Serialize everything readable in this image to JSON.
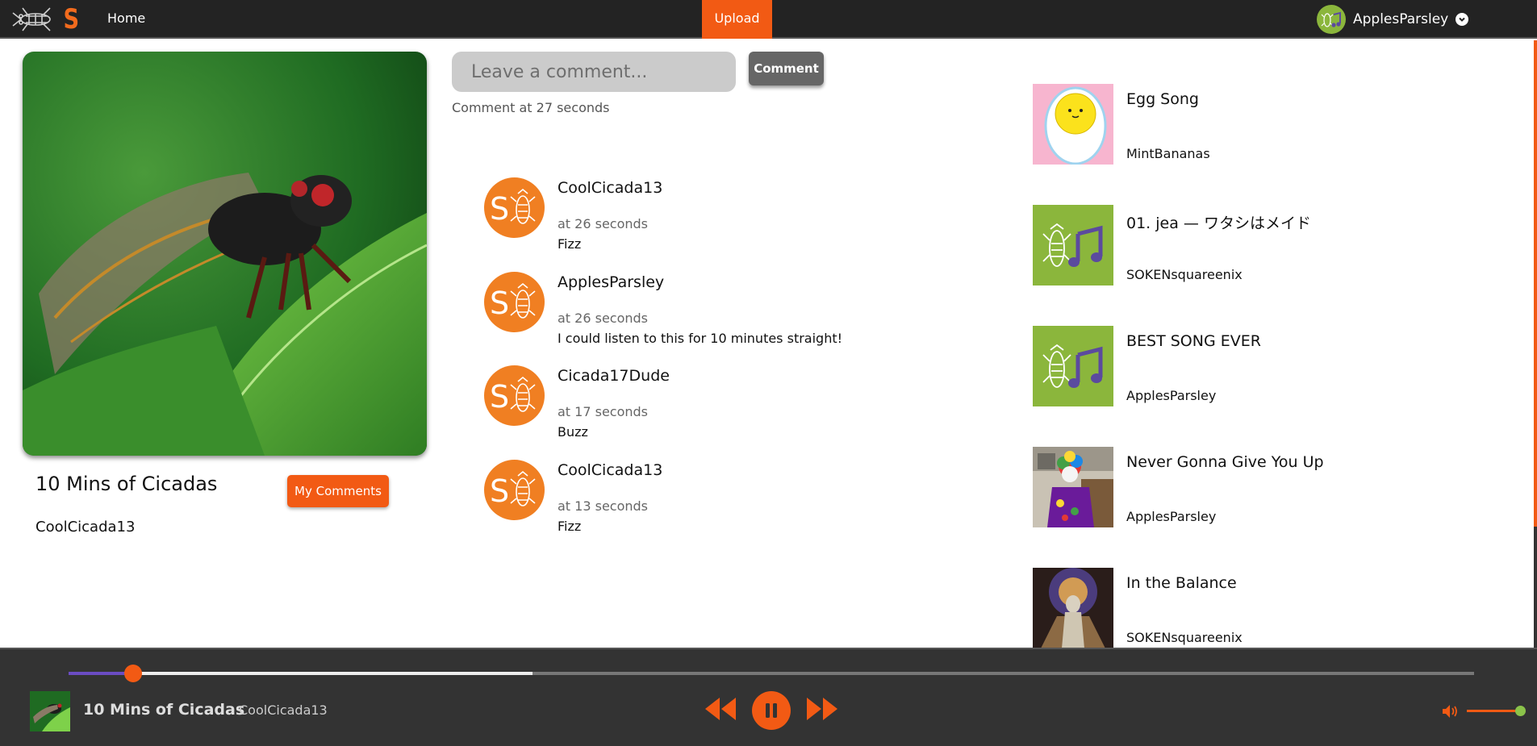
{
  "nav": {
    "logo_letter": "S",
    "home_label": "Home",
    "upload_label": "Upload",
    "username": "ApplesParsley"
  },
  "song": {
    "title": "10 Mins of Cicadas",
    "artist": "CoolCicada13",
    "my_comments_label": "My Comments"
  },
  "comment_form": {
    "placeholder": "Leave a comment...",
    "button_label": "Comment",
    "timestamp_text": "Comment at 27 seconds"
  },
  "comments": [
    {
      "user": "CoolCicada13",
      "time": "at 26 seconds",
      "body": "Fizz"
    },
    {
      "user": "ApplesParsley",
      "time": "at 26 seconds",
      "body": "I could listen to this for 10 minutes straight!"
    },
    {
      "user": "Cicada17Dude",
      "time": "at 17 seconds",
      "body": "Buzz"
    },
    {
      "user": "CoolCicada13",
      "time": "at 13 seconds",
      "body": "Fizz"
    }
  ],
  "songlist": [
    {
      "title": "Egg Song",
      "artist": "MintBananas",
      "thumb": "egg-thumbnail"
    },
    {
      "title": "01. jea — ワタシはメイド",
      "artist": "SOKENsquareenix",
      "thumb": "default-music-thumbnail"
    },
    {
      "title": "BEST SONG EVER",
      "artist": "ApplesParsley",
      "thumb": "default-music-thumbnail"
    },
    {
      "title": "Never Gonna Give You Up",
      "artist": "ApplesParsley",
      "thumb": "clown-thumbnail"
    },
    {
      "title": "In the Balance",
      "artist": "SOKENsquareenix",
      "thumb": "statue-thumbnail"
    }
  ],
  "player": {
    "title": "10 Mins of Cicadas",
    "artist": "CoolCicada13",
    "progress_fraction": 0.046,
    "buffered_fraction": 0.33,
    "volume_fraction": 1.0,
    "state": "playing"
  },
  "colors": {
    "accent": "#f25a14",
    "nav_bg": "#232323",
    "player_bg": "#333333",
    "progress": "#6a4cc2",
    "avatar_green": "#8bb63c",
    "comment_avatar": "#f07f22"
  }
}
